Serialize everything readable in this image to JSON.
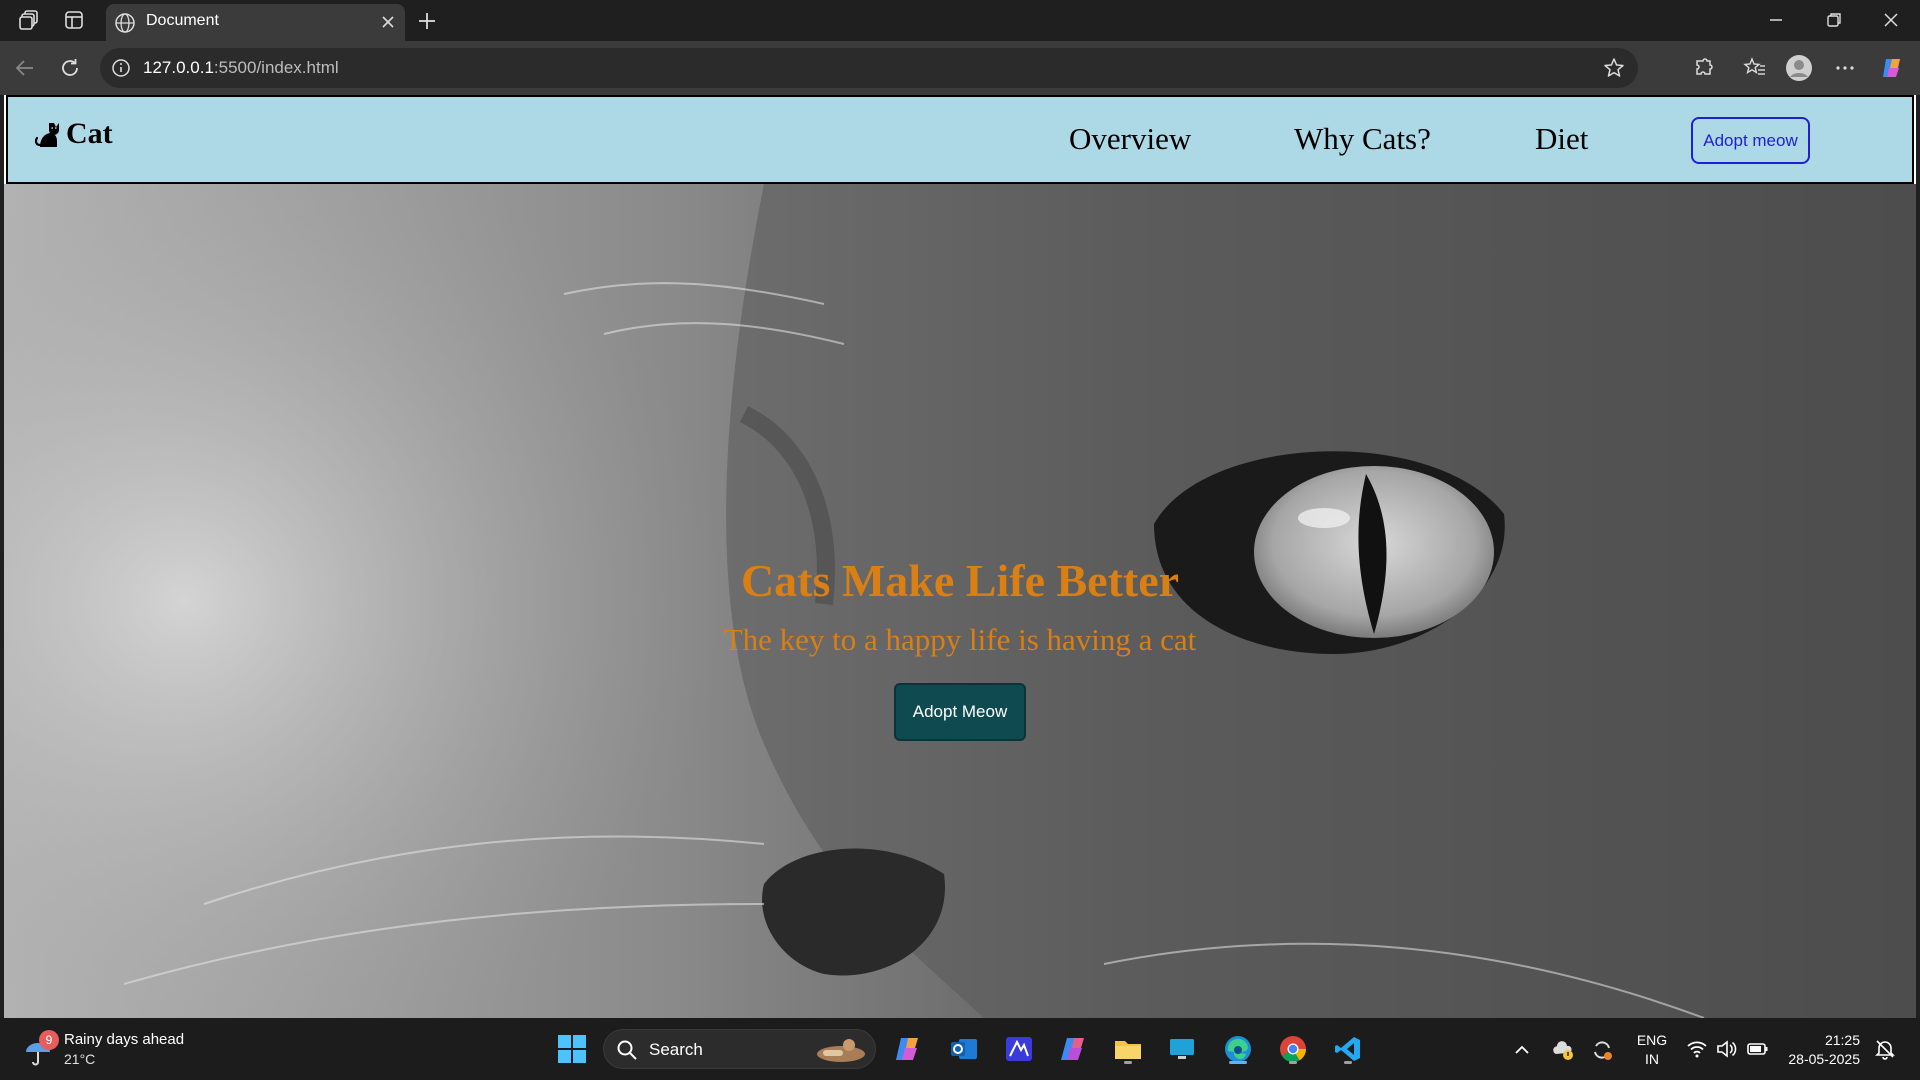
{
  "browser": {
    "tab_title": "Document",
    "url_host": "127.0.0.1",
    "url_path": ":5500/index.html"
  },
  "site": {
    "brand_text": "Cat",
    "brand_icon": "cat-icon",
    "nav": [
      "Overview",
      "Why Cats?",
      "Diet"
    ],
    "nav_button": "Adopt meow",
    "nav_background": "#add8e6",
    "hero": {
      "title": "Cats Make Life Better",
      "subtitle": "The key to a happy life is having a cat",
      "button": "Adopt Meow",
      "accent_color": "#d97f14",
      "button_color": "#0e4a4f"
    }
  },
  "taskbar": {
    "weather_badge": "9",
    "weather_text": "Rainy days ahead",
    "weather_temp": "21°C",
    "search_label": "Search",
    "language": "ENG",
    "region": "IN",
    "time": "21:25",
    "date": "28-05-2025"
  }
}
